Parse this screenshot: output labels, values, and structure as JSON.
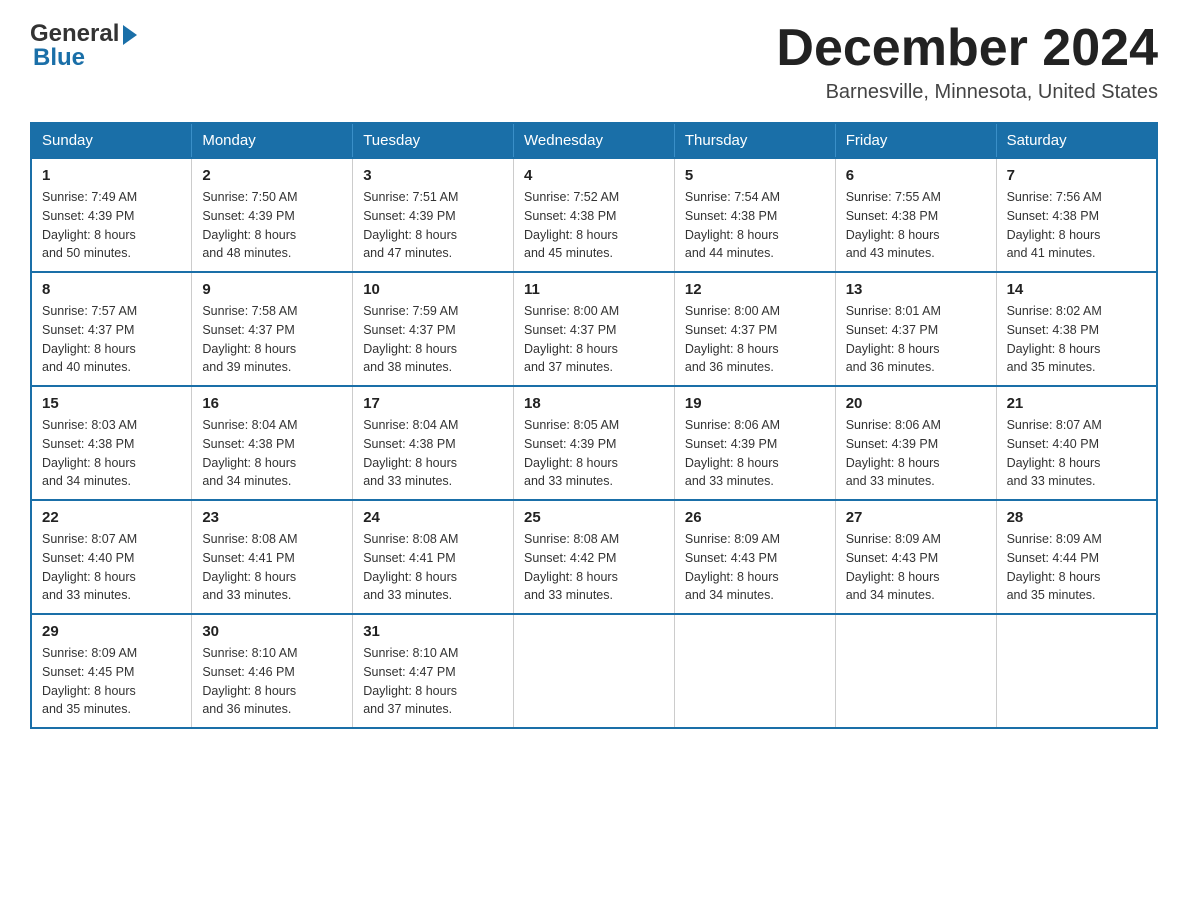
{
  "header": {
    "logo": {
      "general": "General",
      "blue": "Blue",
      "arrow": "▶"
    },
    "title": "December 2024",
    "subtitle": "Barnesville, Minnesota, United States"
  },
  "calendar": {
    "days_of_week": [
      "Sunday",
      "Monday",
      "Tuesday",
      "Wednesday",
      "Thursday",
      "Friday",
      "Saturday"
    ],
    "weeks": [
      [
        {
          "day": "1",
          "sunrise": "7:49 AM",
          "sunset": "4:39 PM",
          "daylight": "8 hours and 50 minutes."
        },
        {
          "day": "2",
          "sunrise": "7:50 AM",
          "sunset": "4:39 PM",
          "daylight": "8 hours and 48 minutes."
        },
        {
          "day": "3",
          "sunrise": "7:51 AM",
          "sunset": "4:39 PM",
          "daylight": "8 hours and 47 minutes."
        },
        {
          "day": "4",
          "sunrise": "7:52 AM",
          "sunset": "4:38 PM",
          "daylight": "8 hours and 45 minutes."
        },
        {
          "day": "5",
          "sunrise": "7:54 AM",
          "sunset": "4:38 PM",
          "daylight": "8 hours and 44 minutes."
        },
        {
          "day": "6",
          "sunrise": "7:55 AM",
          "sunset": "4:38 PM",
          "daylight": "8 hours and 43 minutes."
        },
        {
          "day": "7",
          "sunrise": "7:56 AM",
          "sunset": "4:38 PM",
          "daylight": "8 hours and 41 minutes."
        }
      ],
      [
        {
          "day": "8",
          "sunrise": "7:57 AM",
          "sunset": "4:37 PM",
          "daylight": "8 hours and 40 minutes."
        },
        {
          "day": "9",
          "sunrise": "7:58 AM",
          "sunset": "4:37 PM",
          "daylight": "8 hours and 39 minutes."
        },
        {
          "day": "10",
          "sunrise": "7:59 AM",
          "sunset": "4:37 PM",
          "daylight": "8 hours and 38 minutes."
        },
        {
          "day": "11",
          "sunrise": "8:00 AM",
          "sunset": "4:37 PM",
          "daylight": "8 hours and 37 minutes."
        },
        {
          "day": "12",
          "sunrise": "8:00 AM",
          "sunset": "4:37 PM",
          "daylight": "8 hours and 36 minutes."
        },
        {
          "day": "13",
          "sunrise": "8:01 AM",
          "sunset": "4:37 PM",
          "daylight": "8 hours and 36 minutes."
        },
        {
          "day": "14",
          "sunrise": "8:02 AM",
          "sunset": "4:38 PM",
          "daylight": "8 hours and 35 minutes."
        }
      ],
      [
        {
          "day": "15",
          "sunrise": "8:03 AM",
          "sunset": "4:38 PM",
          "daylight": "8 hours and 34 minutes."
        },
        {
          "day": "16",
          "sunrise": "8:04 AM",
          "sunset": "4:38 PM",
          "daylight": "8 hours and 34 minutes."
        },
        {
          "day": "17",
          "sunrise": "8:04 AM",
          "sunset": "4:38 PM",
          "daylight": "8 hours and 33 minutes."
        },
        {
          "day": "18",
          "sunrise": "8:05 AM",
          "sunset": "4:39 PM",
          "daylight": "8 hours and 33 minutes."
        },
        {
          "day": "19",
          "sunrise": "8:06 AM",
          "sunset": "4:39 PM",
          "daylight": "8 hours and 33 minutes."
        },
        {
          "day": "20",
          "sunrise": "8:06 AM",
          "sunset": "4:39 PM",
          "daylight": "8 hours and 33 minutes."
        },
        {
          "day": "21",
          "sunrise": "8:07 AM",
          "sunset": "4:40 PM",
          "daylight": "8 hours and 33 minutes."
        }
      ],
      [
        {
          "day": "22",
          "sunrise": "8:07 AM",
          "sunset": "4:40 PM",
          "daylight": "8 hours and 33 minutes."
        },
        {
          "day": "23",
          "sunrise": "8:08 AM",
          "sunset": "4:41 PM",
          "daylight": "8 hours and 33 minutes."
        },
        {
          "day": "24",
          "sunrise": "8:08 AM",
          "sunset": "4:41 PM",
          "daylight": "8 hours and 33 minutes."
        },
        {
          "day": "25",
          "sunrise": "8:08 AM",
          "sunset": "4:42 PM",
          "daylight": "8 hours and 33 minutes."
        },
        {
          "day": "26",
          "sunrise": "8:09 AM",
          "sunset": "4:43 PM",
          "daylight": "8 hours and 34 minutes."
        },
        {
          "day": "27",
          "sunrise": "8:09 AM",
          "sunset": "4:43 PM",
          "daylight": "8 hours and 34 minutes."
        },
        {
          "day": "28",
          "sunrise": "8:09 AM",
          "sunset": "4:44 PM",
          "daylight": "8 hours and 35 minutes."
        }
      ],
      [
        {
          "day": "29",
          "sunrise": "8:09 AM",
          "sunset": "4:45 PM",
          "daylight": "8 hours and 35 minutes."
        },
        {
          "day": "30",
          "sunrise": "8:10 AM",
          "sunset": "4:46 PM",
          "daylight": "8 hours and 36 minutes."
        },
        {
          "day": "31",
          "sunrise": "8:10 AM",
          "sunset": "4:47 PM",
          "daylight": "8 hours and 37 minutes."
        },
        null,
        null,
        null,
        null
      ]
    ],
    "sunrise_label": "Sunrise:",
    "sunset_label": "Sunset:",
    "daylight_label": "Daylight:"
  }
}
